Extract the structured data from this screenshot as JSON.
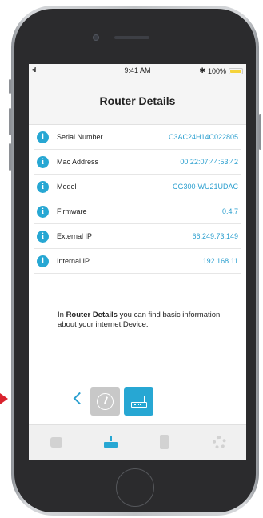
{
  "status_bar": {
    "signal": "•ıl",
    "time": "9:41 AM",
    "bluetooth": "✱",
    "battery_percent": "100%",
    "battery_level": 1.0
  },
  "header": {
    "title": "Router Details"
  },
  "details": [
    {
      "label": "Serial Number",
      "value": "C3AC24H14C022805"
    },
    {
      "label": "Mac Address",
      "value": "00:22:07:44:53:42"
    },
    {
      "label": "Model",
      "value": "CG300-WU21UDAC"
    },
    {
      "label": "Firmware",
      "value": "0.4.7"
    },
    {
      "label": "External IP",
      "value": "66.249.73.149"
    },
    {
      "label": "Internal IP",
      "value": "192.168.11"
    }
  ],
  "info_icon_glyph": "i",
  "help": {
    "prefix": "In ",
    "bold": "Router Details",
    "suffix": " you can find basic information about your internet Device."
  },
  "carousel": {
    "items": [
      "gauge-icon",
      "router-icon"
    ],
    "selected": "router-icon"
  },
  "tab_bar": {
    "items": [
      "dashboard-icon",
      "router-icon",
      "phone-icon",
      "gear-icon"
    ],
    "active": "router-icon"
  },
  "colors": {
    "accent": "#27a7d3",
    "value_text": "#2b9fcf",
    "marker": "#d9232e"
  }
}
